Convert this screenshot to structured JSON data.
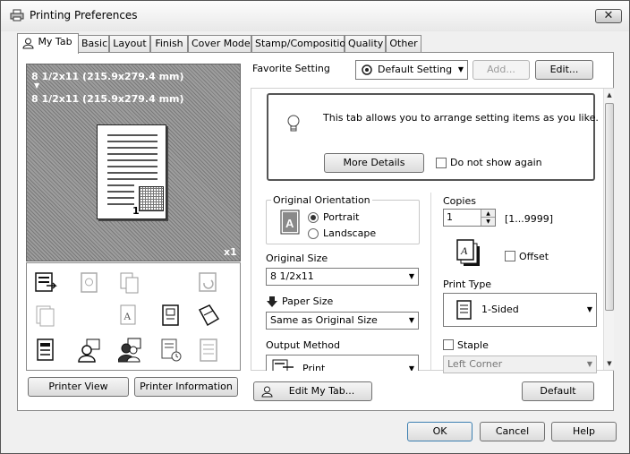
{
  "window": {
    "title": "Printing Preferences",
    "close_symbol": "✕"
  },
  "tabs": [
    {
      "label": "My Tab",
      "active": true
    },
    {
      "label": "Basic"
    },
    {
      "label": "Layout"
    },
    {
      "label": "Finish"
    },
    {
      "label": "Cover Mode"
    },
    {
      "label": "Stamp/Composition"
    },
    {
      "label": "Quality"
    },
    {
      "label": "Other"
    }
  ],
  "preview": {
    "line1": "8 1/2x11 (215.9x279.4 mm)",
    "arrow": "▼",
    "line2": "8 1/2x11 (215.9x279.4 mm)",
    "page_number": "1",
    "copies_badge": "x1"
  },
  "favorite": {
    "label": "Favorite Setting",
    "value": "Default Setting",
    "add_label": "Add...",
    "edit_label": "Edit..."
  },
  "info": {
    "text": "This tab allows you to arrange setting items as you like.",
    "more_details_label": "More Details",
    "dont_show_label": "Do not show again"
  },
  "orientation": {
    "title": "Original Orientation",
    "portrait": "Portrait",
    "landscape": "Landscape",
    "selected": "Portrait"
  },
  "original_size": {
    "label": "Original Size",
    "value": "8 1/2x11"
  },
  "paper_size": {
    "label": "Paper Size",
    "value": "Same as Original Size"
  },
  "output_method": {
    "label": "Output Method",
    "value": "Print"
  },
  "copies": {
    "label": "Copies",
    "value": "1",
    "range": "[1...9999]"
  },
  "offset": {
    "label": "Offset",
    "checked": false
  },
  "print_type": {
    "label": "Print Type",
    "value": "1-Sided"
  },
  "staple": {
    "label": "Staple",
    "checked": false,
    "value": "Left Corner"
  },
  "buttons": {
    "printer_view": "Printer View",
    "printer_information": "Printer Information",
    "edit_my_tab": "Edit My Tab...",
    "default": "Default",
    "ok": "OK",
    "cancel": "Cancel",
    "help": "Help"
  },
  "icons": [
    "output-method-icon",
    "overlay-icon",
    "copy-security-icon",
    "combination-icon",
    "page-stack-icon",
    "orientation-a-icon",
    "staple-icon",
    "fold-icon",
    "document-icon",
    "user-icon",
    "account-icon",
    "scheduled-print-icon",
    "banner-icon"
  ]
}
